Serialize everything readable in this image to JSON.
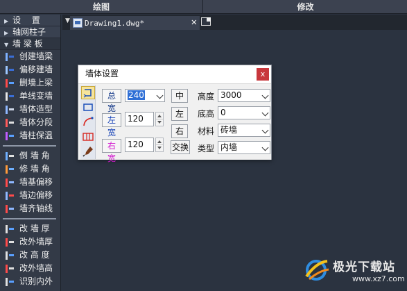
{
  "menu": {
    "section_draw": "绘图",
    "section_modify": "修改"
  },
  "sidebar": {
    "headers": [
      {
        "label": "设　 置",
        "expanded": false
      },
      {
        "label": "轴网柱子",
        "expanded": false
      },
      {
        "label": "墙 梁 板",
        "expanded": true
      }
    ],
    "group1": [
      {
        "label": "创建墙梁",
        "icon": "create-wall-icon"
      },
      {
        "label": "偏移建墙",
        "icon": "offset-wall-icon"
      },
      {
        "label": "删墙上梁",
        "icon": "delete-beam-icon"
      },
      {
        "label": "单线变墙",
        "icon": "line-to-wall-icon"
      },
      {
        "label": "墙体造型",
        "icon": "wall-shape-icon"
      },
      {
        "label": "墙体分段",
        "icon": "wall-segment-icon"
      },
      {
        "label": "墙柱保温",
        "icon": "insulation-icon"
      }
    ],
    "group2": [
      {
        "label": "倒 墙 角",
        "icon": "wall-corner-icon"
      },
      {
        "label": "修 墙 角",
        "icon": "fix-corner-icon"
      },
      {
        "label": "墙基偏移",
        "icon": "base-offset-icon"
      },
      {
        "label": "墙边偏移",
        "icon": "edge-offset-icon"
      },
      {
        "label": "墙齐轴线",
        "icon": "align-axis-icon"
      }
    ],
    "group3": [
      {
        "label": "改 墙 厚",
        "icon": "change-thickness-icon"
      },
      {
        "label": "改外墙厚",
        "icon": "change-outer-thickness-icon"
      },
      {
        "label": "改 高 度",
        "icon": "change-height-icon"
      },
      {
        "label": "改外墙高",
        "icon": "change-outer-height-icon"
      },
      {
        "label": "识别内外",
        "icon": "identify-icon"
      }
    ]
  },
  "document": {
    "tab_title": "Drawing1.dwg*",
    "close_glyph": "✕"
  },
  "dialog": {
    "title": "墙体设置",
    "close_glyph": "x",
    "total_width_label": "总宽",
    "total_width_value": "240",
    "left_width_label": "左宽",
    "left_width_value": "120",
    "right_width_label": "右宽",
    "right_width_value": "120",
    "align_center": "中",
    "align_left": "左",
    "align_right": "右",
    "swap": "交换",
    "height_label": "高度",
    "height_value": "3000",
    "base_label": "底高",
    "base_value": "0",
    "material_label": "材料",
    "material_value": "砖墙",
    "type_label": "类型",
    "type_value": "内墙"
  },
  "watermark": {
    "brand": "极光下载站",
    "url": "www.xz7.com"
  },
  "colors": {
    "background": "#2b3340",
    "sidebar": "#333a47",
    "dialog_close": "#c8373c",
    "right_label": "#d21ccf",
    "left_label": "#1945b8",
    "selection": "#2f6fd6"
  }
}
